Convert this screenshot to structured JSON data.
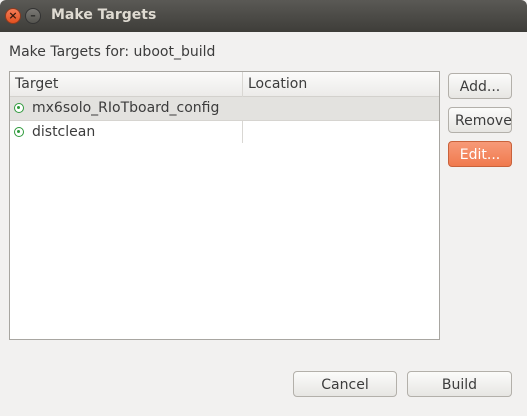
{
  "window": {
    "title": "Make Targets"
  },
  "dialog": {
    "subtitle": "Make Targets for: uboot_build"
  },
  "table": {
    "columns": [
      "Target",
      "Location"
    ],
    "rows": [
      {
        "target": "mx6solo_RIoTboard_config",
        "location": "",
        "selected": true,
        "icon": "make-target-icon"
      },
      {
        "target": "distclean",
        "location": "",
        "selected": false,
        "icon": "make-target-icon"
      }
    ]
  },
  "side_buttons": {
    "add": "Add...",
    "remove": "Remove",
    "edit": "Edit..."
  },
  "footer_buttons": {
    "cancel": "Cancel",
    "build": "Build"
  },
  "colors": {
    "accent": "#f07a4e",
    "titlebar": "#3e3d39",
    "icon_green": "#2f9a3c"
  }
}
